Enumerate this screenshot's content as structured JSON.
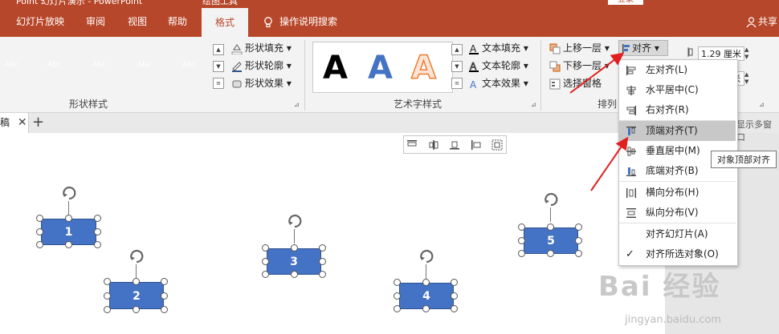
{
  "window": {
    "title_text": "Point 幻灯片演示 - PowerPoint",
    "context_tab": "绘图工具",
    "signin": "登录"
  },
  "tabs": [
    "幻灯片放映",
    "审阅",
    "视图",
    "帮助",
    "格式"
  ],
  "tellme": "操作说明搜索",
  "share": "共享",
  "shape_styles": {
    "swatches": [
      {
        "label": "Abc",
        "color": "#ed7d31"
      },
      {
        "label": "Abc",
        "color": "#a5a5a5"
      },
      {
        "label": "Abc",
        "color": "#ffc000"
      },
      {
        "label": "Abc",
        "color": "#5b9bd5"
      },
      {
        "label": "Abc",
        "color": "#70ad47"
      }
    ],
    "fill": "形状填充",
    "outline": "形状轮廓",
    "effects": "形状效果",
    "group_label": "形状样式"
  },
  "wordart": {
    "letters": [
      {
        "glyph": "A",
        "color": "#000000"
      },
      {
        "glyph": "A",
        "color": "#4472c4"
      },
      {
        "glyph": "A",
        "color": "#f4b183"
      }
    ],
    "text_fill": "文本填充",
    "text_outline": "文本轮廓",
    "text_effects": "文本效果",
    "group_label": "艺术字样式"
  },
  "arrange": {
    "bring_forward": "上移一层",
    "send_backward": "下移一层",
    "selection_pane": "选择窗格",
    "align": "对齐",
    "group_label": "排列"
  },
  "size": {
    "height": "1.29 厘米",
    "width_suffix": "米"
  },
  "doc_tab": "稿",
  "right_hint": "显示多窗口",
  "shapes": [
    {
      "label": "1"
    },
    {
      "label": "2"
    },
    {
      "label": "3"
    },
    {
      "label": "4"
    },
    {
      "label": "5"
    }
  ],
  "align_menu": {
    "items": [
      {
        "label": "左对齐(L)",
        "icon": "align-left-icon"
      },
      {
        "label": "水平居中(C)",
        "icon": "align-center-icon"
      },
      {
        "label": "右对齐(R)",
        "icon": "align-right-icon"
      },
      {
        "label": "顶端对齐(T)",
        "icon": "align-top-icon"
      },
      {
        "label": "垂直居中(M)",
        "icon": "align-middle-icon"
      },
      {
        "label": "底端对齐(B)",
        "icon": "align-bottom-icon"
      },
      {
        "label": "横向分布(H)",
        "icon": "distribute-horizontal-icon"
      },
      {
        "label": "纵向分布(V)",
        "icon": "distribute-vertical-icon"
      },
      {
        "label": "对齐幻灯片(A)",
        "icon": ""
      },
      {
        "label": "对齐所选对象(O)",
        "icon": "checkmark-icon"
      }
    ]
  },
  "tooltip": "对象顶部对齐",
  "watermark": {
    "brand": "Bai 经验",
    "url": "jingyan.baidu.com"
  },
  "colors": {
    "accent": "#b7472a",
    "shape_fill": "#4472c4",
    "annotation_arrow": "#e02020"
  }
}
